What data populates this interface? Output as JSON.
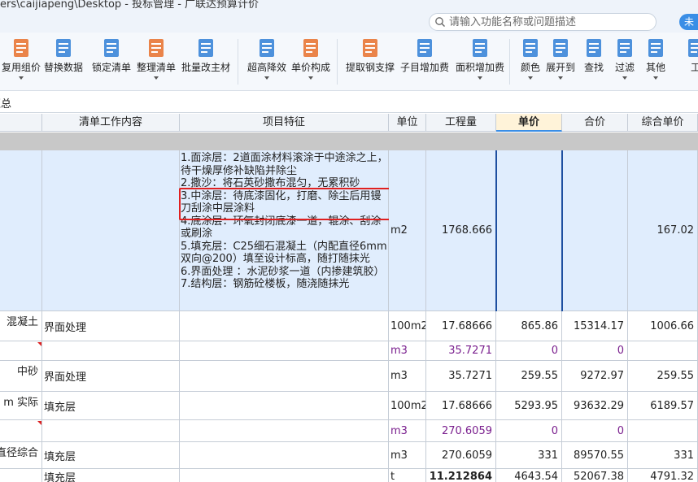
{
  "window": {
    "path": "ers\\caijiapeng\\Desktop - 投标管理 - 广联达预算计价",
    "user_label": "未"
  },
  "search": {
    "placeholder": "请输入功能名称或问题描述"
  },
  "toolbar": {
    "items": [
      {
        "label": "复用组价",
        "icon": "reuse-icon",
        "caret": true
      },
      {
        "label": "替换数据",
        "icon": "replace-icon",
        "caret": false
      },
      {
        "label": "锁定清单",
        "icon": "lock-icon",
        "caret": false
      },
      {
        "label": "整理清单",
        "icon": "organize-icon",
        "caret": true
      },
      {
        "label": "批量改主材",
        "icon": "batch-edit-icon",
        "caret": false
      },
      {
        "label": "超高降效",
        "icon": "high-rise-icon",
        "caret": true
      },
      {
        "label": "单价构成",
        "icon": "price-compose-icon",
        "caret": true
      },
      {
        "label": "提取钢支撑",
        "icon": "steel-support-icon",
        "caret": false
      },
      {
        "label": "子目增加费",
        "icon": "sub-add-icon",
        "caret": false
      },
      {
        "label": "面积增加费",
        "icon": "area-add-icon",
        "caret": true
      },
      {
        "label": "颜色",
        "icon": "color-icon",
        "caret": true
      },
      {
        "label": "展开到",
        "icon": "expand-icon",
        "caret": true
      },
      {
        "label": "查找",
        "icon": "find-icon",
        "caret": false
      },
      {
        "label": "过滤",
        "icon": "filter-icon",
        "caret": true
      },
      {
        "label": "其他",
        "icon": "other-icon",
        "caret": true
      },
      {
        "label": "工",
        "icon": "tool-icon",
        "caret": false
      }
    ]
  },
  "tab": {
    "label": "汇总"
  },
  "columns": [
    "清单工作内容",
    "项目特征",
    "单位",
    "工程量",
    "单价",
    "合价",
    "综合单价"
  ],
  "selected_row": {
    "features": [
      "1.面涂层：2道面涂材料滚涂于中途涂之上，待干燥厚修补缺陷并除尘",
      "2.撒沙：将石英砂撒布混匀，无累积砂",
      "3.中涂层：待底漆固化，打磨、除尘后用镘刀刮涂中层涂料",
      "4.底涂层：环氧封闭底漆一道，辊涂、刮涂或刷涂",
      "5.填充层：C25细石混凝土（内配直径6mm双向@200）填至设计标高，随打随抹光",
      "6.界面处理 ：水泥砂浆一道（内掺建筑胶）",
      "7.结构层：钢筋砼楼板，随浇随抹光"
    ],
    "unit": "m2",
    "quantity": "1768.666",
    "composite_price": "167.02"
  },
  "rows": [
    {
      "left": "混凝土",
      "content": "界面处理",
      "unit": "100m2",
      "qty": "17.68666",
      "price": "865.86",
      "total": "15314.17",
      "comp": "1006.66",
      "purple": false,
      "bold": false,
      "tri": false
    },
    {
      "left": "",
      "content": "",
      "unit": "m3",
      "qty": "35.7271",
      "price": "0",
      "total": "0",
      "comp": "",
      "purple": true,
      "bold": false,
      "tri": true
    },
    {
      "left": "中砂",
      "content": "界面处理",
      "unit": "m3",
      "qty": "35.7271",
      "price": "259.55",
      "total": "9272.97",
      "comp": "259.55",
      "purple": false,
      "bold": false,
      "tri": false
    },
    {
      "left": "m 实际",
      "content": "填充层",
      "unit": "100m2",
      "qty": "17.68666",
      "price": "5293.95",
      "total": "93632.29",
      "comp": "6189.57",
      "purple": false,
      "bold": false,
      "tri": false
    },
    {
      "left": "",
      "content": "",
      "unit": "m3",
      "qty": "270.6059",
      "price": "0",
      "total": "0",
      "comp": "",
      "purple": true,
      "bold": false,
      "tri": true
    },
    {
      "left": "直径综合",
      "content": "填充层",
      "unit": "m3",
      "qty": "270.6059",
      "price": "331",
      "total": "89570.55",
      "comp": "331",
      "purple": false,
      "bold": false,
      "tri": false
    },
    {
      "left": "",
      "content": "填充层",
      "unit": "t",
      "qty": "11.212864",
      "price": "4643.54",
      "total": "52067.38",
      "comp": "4791.32",
      "purple": false,
      "bold": true,
      "tri": false
    }
  ],
  "colors": {
    "accent": "#3a8ee6",
    "highlight": "#e02020",
    "selection": "#e0edfd",
    "purple_text": "#7a1f8e"
  }
}
